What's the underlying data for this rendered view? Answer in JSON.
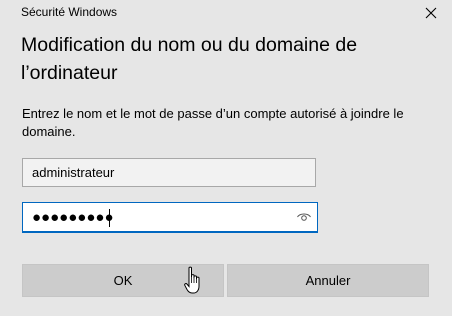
{
  "window": {
    "title": "Sécurité Windows",
    "close_icon": "close-icon"
  },
  "dialog": {
    "heading": "Modification du nom ou du domaine de l’ordinateur",
    "description": "Entrez le nom et le mot de passe d’un compte autorisé à joindre le domaine."
  },
  "username": {
    "value": "administrateur"
  },
  "password": {
    "masked_value": "●●●●●●●●●",
    "reveal_icon": "eye-icon"
  },
  "buttons": {
    "ok_label": "OK",
    "cancel_label": "Annuler"
  },
  "colors": {
    "background": "#e6e6e6",
    "focus_border": "#0067c0",
    "button_bg": "#cccccc"
  },
  "pointer_icon": "hand-pointer-icon"
}
